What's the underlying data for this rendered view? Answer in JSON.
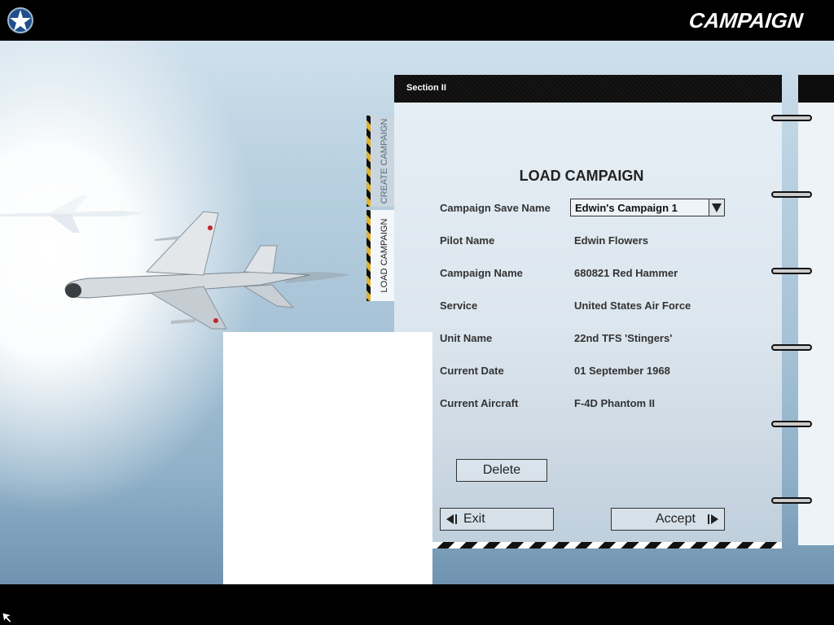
{
  "header": {
    "title": "CAMPAIGN",
    "logo_icon": "star-emblem-icon"
  },
  "notebook": {
    "section": "Section II",
    "heading": "LOAD CAMPAIGN",
    "tabs": [
      {
        "label": "CREATE CAMPAIGN",
        "active": false
      },
      {
        "label": "LOAD CAMPAIGN",
        "active": true
      }
    ],
    "fields": {
      "save_name": {
        "label": "Campaign Save Name",
        "value": "Edwin's Campaign 1"
      },
      "pilot_name": {
        "label": "Pilot Name",
        "value": "Edwin Flowers"
      },
      "campaign_name": {
        "label": "Campaign Name",
        "value": "680821 Red Hammer"
      },
      "service": {
        "label": "Service",
        "value": "United States Air Force"
      },
      "unit_name": {
        "label": "Unit Name",
        "value": "22nd TFS 'Stingers'"
      },
      "current_date": {
        "label": "Current Date",
        "value": "01 September 1968"
      },
      "current_aircraft": {
        "label": "Current Aircraft",
        "value": "F-4D Phantom II"
      }
    },
    "buttons": {
      "delete": "Delete",
      "exit": "Exit",
      "accept": "Accept"
    }
  },
  "colors": {
    "header_bg": "#000000",
    "tab_stripe": "#e1b32a",
    "page_bg": "#e6eef5"
  }
}
